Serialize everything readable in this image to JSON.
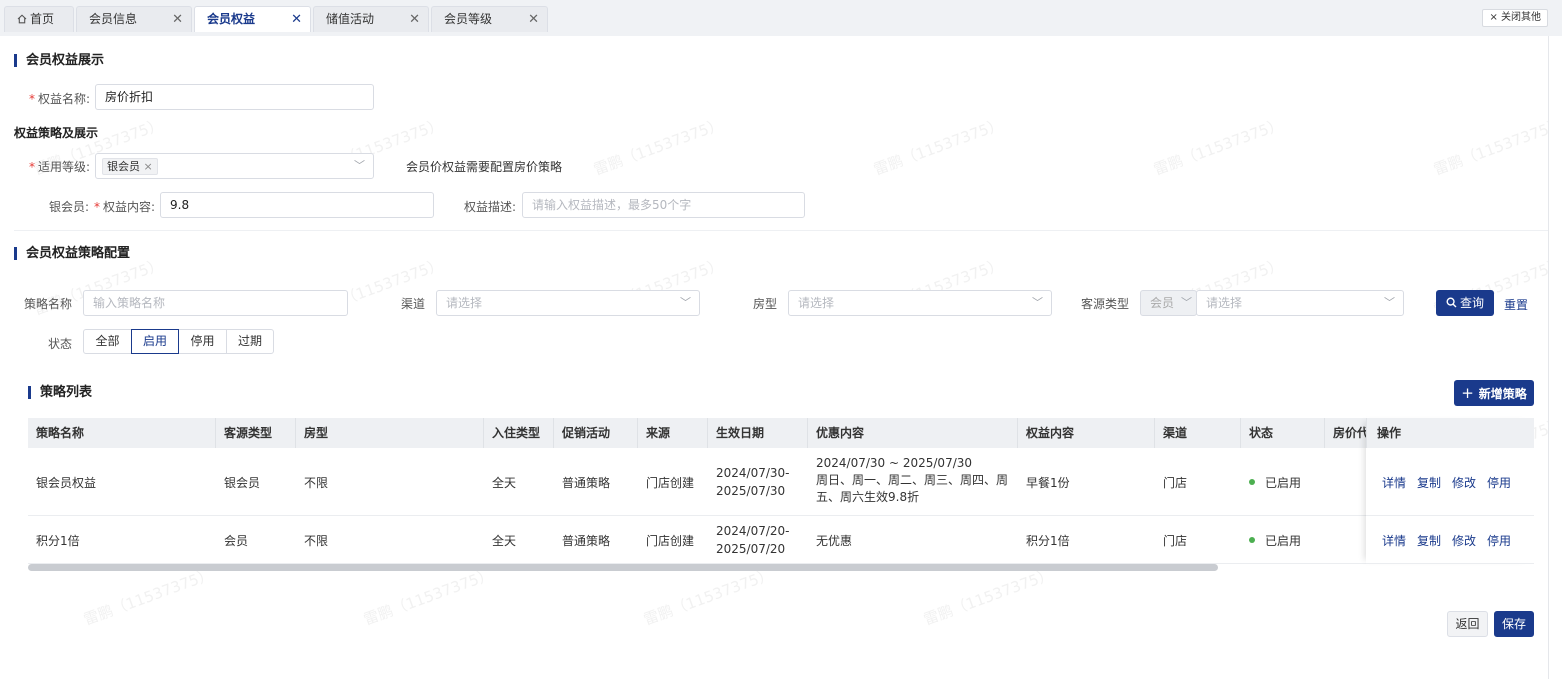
{
  "tabs": [
    {
      "label": "首页",
      "icon": "home-icon",
      "closable": false
    },
    {
      "label": "会员信息",
      "closable": true
    },
    {
      "label": "会员权益",
      "closable": true,
      "active": true
    },
    {
      "label": "储值活动",
      "closable": true
    },
    {
      "label": "会员等级",
      "closable": true
    }
  ],
  "close_others": "× 关闭其他",
  "section1": {
    "title": "会员权益展示",
    "name_label": "权益名称:",
    "name_value": "房价折扣",
    "strategy_title": "权益策略及展示",
    "level_label": "适用等级:",
    "level_tag": "银会员",
    "level_hint": "会员价权益需要配置房价策略",
    "member_label": "银会员:",
    "content_label": "权益内容:",
    "content_value": "9.8",
    "desc_label": "权益描述:",
    "desc_placeholder": "请输入权益描述，最多50个字"
  },
  "section2": {
    "title": "会员权益策略配置",
    "filters": {
      "strategy_name_label": "策略名称",
      "strategy_name_placeholder": "输入策略名称",
      "channel_label": "渠道",
      "channel_placeholder": "请选择",
      "room_type_label": "房型",
      "room_type_placeholder": "请选择",
      "source_type_label": "客源类型",
      "source_type_prefix": "会员",
      "source_type_placeholder": "请选择",
      "query_button": "查询",
      "reset_button": "重置",
      "status_label": "状态",
      "status_options": [
        "全部",
        "启用",
        "停用",
        "过期"
      ],
      "status_selected": "启用"
    }
  },
  "list": {
    "title": "策略列表",
    "add_button": "新增策略",
    "columns": [
      "策略名称",
      "客源类型",
      "房型",
      "入住类型",
      "促销活动",
      "来源",
      "生效日期",
      "优惠内容",
      "权益内容",
      "渠道",
      "状态",
      "房价代",
      "操作"
    ],
    "rows": [
      {
        "name": "银会员权益",
        "source_type": "银会员",
        "room_type": "不限",
        "checkin_type": "全天",
        "promotion": "普通策略",
        "origin": "门店创建",
        "date_line1": "2024/07/30-",
        "date_line2": "2025/07/30",
        "discount_line1": "2024/07/30 ~ 2025/07/30",
        "discount_line2": "周日、周一、周二、周三、周四、周",
        "discount_line3": "五、周六生效9.8折",
        "benefit": "早餐1份",
        "channel": "门店",
        "status": "已启用",
        "ops": [
          "详情",
          "复制",
          "修改",
          "停用"
        ]
      },
      {
        "name": "积分1倍",
        "source_type": "会员",
        "room_type": "不限",
        "checkin_type": "全天",
        "promotion": "普通策略",
        "origin": "门店创建",
        "date_line1": "2024/07/20-",
        "date_line2": "2025/07/20",
        "discount_line1": "无优惠",
        "benefit": "积分1倍",
        "channel": "门店",
        "status": "已启用",
        "ops": [
          "详情",
          "复制",
          "修改",
          "停用"
        ]
      }
    ]
  },
  "footer": {
    "back_button": "返回",
    "save_button": "保存"
  },
  "watermark": "雷鹏（11537375）",
  "colors": {
    "primary": "#1a3a8c",
    "status_green": "#4caf50",
    "required": "#e53935"
  }
}
